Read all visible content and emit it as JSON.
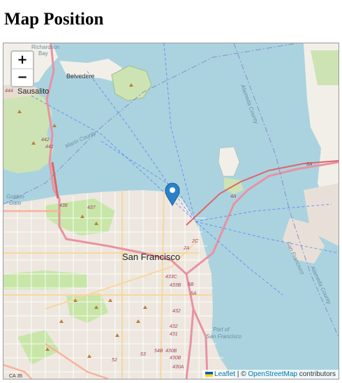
{
  "page": {
    "title": "Map Position"
  },
  "map": {
    "zoom_in_label": "+",
    "zoom_out_label": "−",
    "attribution": {
      "library": "Leaflet",
      "separator": " | © ",
      "source": "OpenStreetMap",
      "suffix": " contributors"
    },
    "marker": {
      "icon": "map-marker-icon",
      "color": "#2a81cb"
    },
    "labels": {
      "richardson_bay_1": "Richardson",
      "richardson_bay_2": "Bay",
      "belvedere": "Belvedere",
      "sausalito": "Sausalito",
      "marin_county": "Marin County",
      "alameda_county_top": "Alameda County",
      "alameda_county_bottom": "Alameda County",
      "san_francisco_county": "San Francisco",
      "golden_gate_1": "Golden",
      "golden_gate_2": "Gate",
      "san_francisco": "San Francisco",
      "port_sf_1": "Port of",
      "port_sf_2": "San Francisco",
      "ca35": "CA 35",
      "r442": "442",
      "r441": "441",
      "r444": "444",
      "r438": "438",
      "r437": "437",
      "r433c": "433C",
      "r433b": "433B",
      "r432": "432",
      "r431": "431",
      "r430b": "430B",
      "r430a": "430A",
      "r54b": "54B",
      "r53": "53",
      "r52": "52",
      "r5b": "5B",
      "r5a": "5A",
      "r4a": "4A",
      "r8a": "8A",
      "r2a": "2A",
      "r2c": "2C"
    },
    "colors": {
      "water": "#aad3df",
      "land": "#f2efe9",
      "park": "#c8e6a8",
      "urban": "#e8e0d8",
      "motorway": "#e892a2",
      "trunk": "#f9b29c",
      "boundary": "#8c8cf0"
    }
  }
}
